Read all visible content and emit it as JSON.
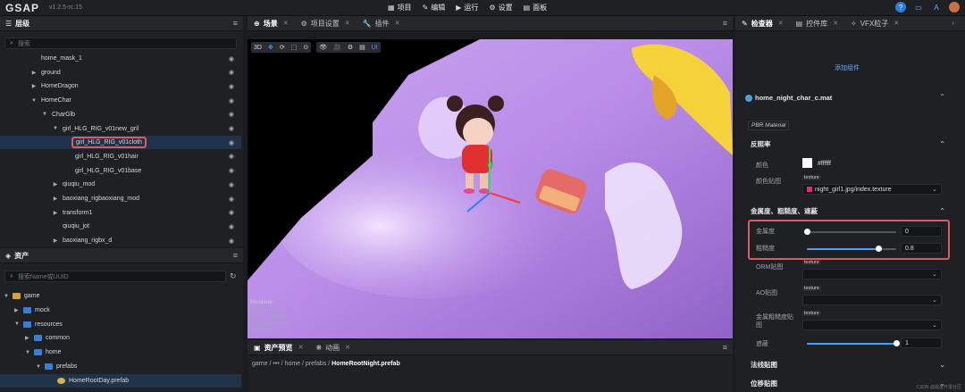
{
  "app": {
    "logo": "GSAP",
    "version": "v1.2.5-rc.15"
  },
  "menu": [
    {
      "icon": "grid-icon",
      "label": "项目"
    },
    {
      "icon": "pencil-icon",
      "label": "编辑"
    },
    {
      "icon": "play-icon",
      "label": "运行"
    },
    {
      "icon": "gear-icon",
      "label": "设置"
    },
    {
      "icon": "panel-icon",
      "label": "面板"
    }
  ],
  "hierarchy": {
    "title": "层级",
    "search_placeholder": "搜索",
    "rows": [
      {
        "label": "home_mask_1",
        "arrow": ""
      },
      {
        "label": "ground",
        "arrow": "▶"
      },
      {
        "label": "HomeDragon",
        "arrow": "▶"
      },
      {
        "label": "HomeChar",
        "arrow": "▼"
      },
      {
        "label": "CharGlb",
        "arrow": "▼"
      },
      {
        "label": "girl_HLG_RIG_v01new_gril",
        "arrow": "▼"
      },
      {
        "label": "girl_HLG_RIG_v01cloth",
        "arrow": ""
      },
      {
        "label": "girl_HLG_RIG_v01hair",
        "arrow": ""
      },
      {
        "label": "girl_HLG_RIG_v01base",
        "arrow": ""
      },
      {
        "label": "qiuqiu_mod",
        "arrow": "▶"
      },
      {
        "label": "baoxiang_rigbaoxiang_mod",
        "arrow": "▶"
      },
      {
        "label": "transform1",
        "arrow": "▶"
      },
      {
        "label": "qiuqiu_jot",
        "arrow": ""
      },
      {
        "label": "baoxiang_rigbx_d",
        "arrow": "▶"
      }
    ]
  },
  "assets": {
    "title": "资产",
    "search_placeholder": "搜索Name或UUID",
    "rows": [
      {
        "label": "game",
        "arrow": "▼"
      },
      {
        "label": "mock",
        "arrow": "▶"
      },
      {
        "label": "resources",
        "arrow": "▼"
      },
      {
        "label": "common",
        "arrow": "▶"
      },
      {
        "label": "home",
        "arrow": "▼"
      },
      {
        "label": "prefabs",
        "arrow": "▼"
      },
      {
        "label": "HomeRootDay.prefab",
        "arrow": ""
      }
    ]
  },
  "scene_tabs": [
    {
      "label": "场景",
      "active": true
    },
    {
      "label": "项目设置"
    },
    {
      "label": "插件"
    }
  ],
  "viewport": {
    "toolbar": [
      "3D",
      "✥",
      "⟳",
      "⬚",
      "⊙"
    ],
    "toolbar2": [
      "👁",
      "🎥",
      "⚙",
      "▤",
      "UI"
    ],
    "stats_title": "Renderer",
    "stats": [
      {
        "k": "objects",
        "v": "238"
      },
      {
        "k": "vertices",
        "v": "38963"
      },
      {
        "k": "triangles",
        "v": "42391"
      },
      {
        "k": "draw calls",
        "v": "1"
      }
    ]
  },
  "bottom_tabs": [
    {
      "label": "资产预览",
      "active": true
    },
    {
      "label": "动画"
    }
  ],
  "breadcrumb": [
    "game",
    "•••",
    "home",
    "prefabs",
    "HomeRootNight.prefab"
  ],
  "inspector": {
    "tabs": [
      {
        "label": "检查器",
        "active": true
      },
      {
        "label": "控件库"
      },
      {
        "label": "VFX粒子"
      }
    ],
    "add_component": "添加组件",
    "material_name": "home_night_char_c.mat",
    "pbr_label": "PBR Material",
    "sections": {
      "diffuse": "反照率",
      "metal": "金属度、粗糙度、遮蔽",
      "normal": "法线贴图",
      "displacement": "位移贴图"
    },
    "color_label": "颜色",
    "color_value": "#ffffff",
    "color_map_label": "颜色贴图",
    "texture_tag": "texture",
    "color_map_value": "night_girl1.jpg/index.texture",
    "metalness_label": "金属度",
    "metalness_value": "0",
    "metalness_frac": 0,
    "roughness_label": "粗糙度",
    "roughness_value": "0.8",
    "roughness_frac": 0.8,
    "orm_label": "ORM贴图",
    "ao_label": "AO贴图",
    "metal_rough_map_label": "金属粗糙度贴图",
    "occlusion_label": "遮蔽",
    "occlusion_value": "1",
    "occlusion_frac": 1
  },
  "watermark": "CSDN @掘金开发社区"
}
